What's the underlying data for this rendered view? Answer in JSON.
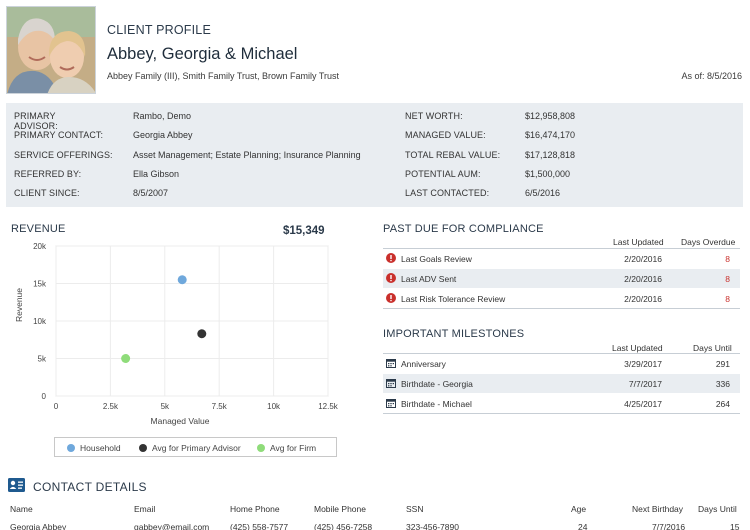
{
  "header": {
    "section_label": "CLIENT PROFILE",
    "client_name": "Abbey, Georgia & Michael",
    "trusts": "Abbey Family (III), Smith Family Trust, Brown Family Trust",
    "as_of": "As of: 8/5/2016"
  },
  "summary": {
    "left": [
      {
        "label": "PRIMARY ADVISOR:",
        "value": "Rambo, Demo"
      },
      {
        "label": "PRIMARY CONTACT:",
        "value": "Georgia Abbey"
      },
      {
        "label": "SERVICE OFFERINGS:",
        "value": "Asset Management; Estate Planning; Insurance Planning"
      },
      {
        "label": "REFERRED BY:",
        "value": "Ella Gibson"
      },
      {
        "label": "CLIENT SINCE:",
        "value": "8/5/2007"
      }
    ],
    "right": [
      {
        "label": "NET WORTH:",
        "value": "$12,958,808"
      },
      {
        "label": "MANAGED VALUE:",
        "value": "$16,474,170"
      },
      {
        "label": "TOTAL REBAL VALUE:",
        "value": "$17,128,818"
      },
      {
        "label": "POTENTIAL AUM:",
        "value": "$1,500,000"
      },
      {
        "label": "LAST CONTACTED:",
        "value": "6/5/2016"
      }
    ]
  },
  "revenue": {
    "title": "REVENUE",
    "total": "$15,349"
  },
  "chart_data": {
    "type": "scatter",
    "xlabel": "Managed Value",
    "ylabel": "Revenue",
    "xlim": [
      0,
      12500
    ],
    "ylim": [
      0,
      20000
    ],
    "x_ticks": [
      "0",
      "2.5k",
      "5k",
      "7.5k",
      "10k",
      "12.5k"
    ],
    "y_ticks": [
      "0",
      "5k",
      "10k",
      "15k",
      "20k"
    ],
    "legend_position": "bottom",
    "series": [
      {
        "name": "Household",
        "color": "#6fa8dc",
        "x": [
          5800
        ],
        "y": [
          15500
        ]
      },
      {
        "name": "Avg for Primary Advisor",
        "color": "#333333",
        "x": [
          6700
        ],
        "y": [
          8300
        ]
      },
      {
        "name": "Avg for Firm",
        "color": "#8fdc7a",
        "x": [
          3200
        ],
        "y": [
          5000
        ]
      }
    ]
  },
  "compliance": {
    "title": "PAST DUE FOR COMPLIANCE",
    "col_last_updated": "Last Updated",
    "col_days_overdue": "Days Overdue",
    "rows": [
      {
        "item": "Last Goals Review",
        "date": "2/20/2016",
        "days": "8"
      },
      {
        "item": "Last ADV Sent",
        "date": "2/20/2016",
        "days": "8"
      },
      {
        "item": "Last Risk Tolerance Review",
        "date": "2/20/2016",
        "days": "8"
      }
    ],
    "alert_icon": "exclamation-circle-icon",
    "alert_color": "#c9302c"
  },
  "milestones": {
    "title": "IMPORTANT MILESTONES",
    "col_last_updated": "Last Updated",
    "col_days_until": "Days Until",
    "rows": [
      {
        "item": "Anniversary",
        "date": "3/29/2017",
        "days": "291"
      },
      {
        "item": "Birthdate - Georgia",
        "date": "7/7/2017",
        "days": "336"
      },
      {
        "item": "Birthdate - Michael",
        "date": "4/25/2017",
        "days": "264"
      }
    ],
    "icon": "calendar-icon"
  },
  "contact": {
    "title": "CONTACT DETAILS",
    "icon": "address-card-icon",
    "columns": [
      "Name",
      "Email",
      "Home Phone",
      "Mobile Phone",
      "SSN",
      "Age",
      "Next Birthday",
      "Days Until"
    ],
    "row": [
      "Georgia Abbey",
      "gabbey@email.com",
      "(425) 558-7577",
      "(425) 456-7258",
      "323-456-7890",
      "24",
      "7/7/2016",
      "15"
    ]
  }
}
